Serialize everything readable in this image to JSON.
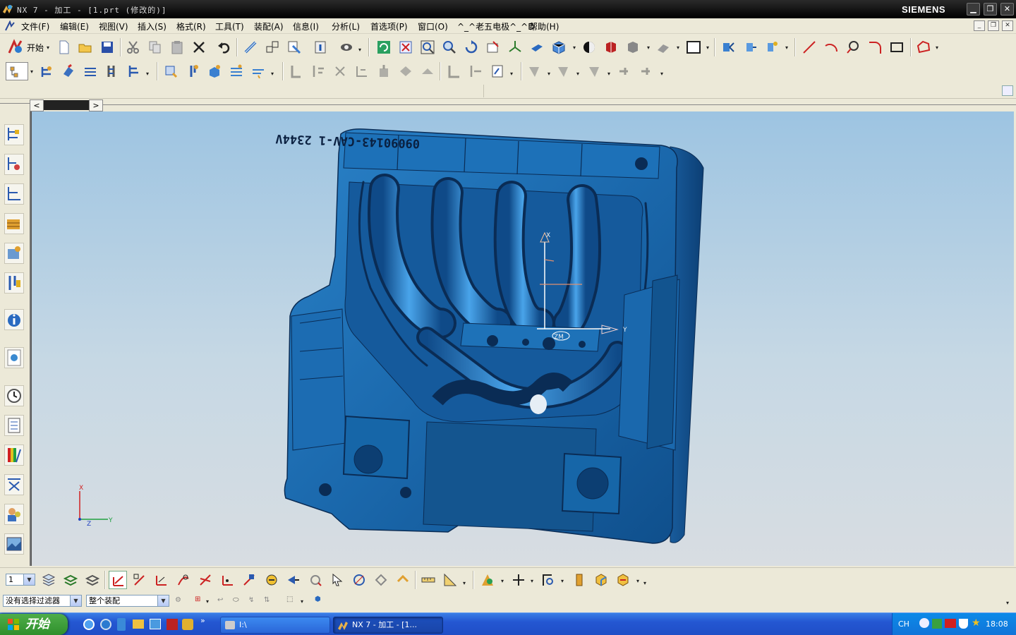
{
  "window": {
    "title": "NX 7 - 加工 - [1.prt (修改的)]",
    "brand": "SIEMENS"
  },
  "menu": [
    "文件(F)",
    "编辑(E)",
    "视图(V)",
    "插入(S)",
    "格式(R)",
    "工具(T)",
    "装配(A)",
    "信息(I)",
    "分析(L)",
    "首选项(P)",
    "窗口(O)",
    "^_^老五电极^_^D",
    "帮助(H)"
  ],
  "toolbar": {
    "start_label": "开始"
  },
  "model": {
    "engraving": "09090143-CAV-1   2344V"
  },
  "triad": {
    "x": "X",
    "y": "Y",
    "z": "Z"
  },
  "wcs": {
    "x": "X",
    "y": "Y",
    "csys": "ZM"
  },
  "layer": {
    "value": "1"
  },
  "filter": {
    "type": "没有选择过滤器",
    "scope": "整个装配"
  },
  "taskbar": {
    "start_label": "开始",
    "tasks": [
      {
        "label": "I:\\"
      },
      {
        "label": "NX 7 - 加工 - [1..."
      }
    ],
    "lang": "CH",
    "clock": "18:08"
  },
  "colors": {
    "model": "#1f6cb0",
    "model_dark": "#0f3e70",
    "titlebar": "#000000",
    "taskbar": "#245edb",
    "start": "#3c9b38"
  }
}
